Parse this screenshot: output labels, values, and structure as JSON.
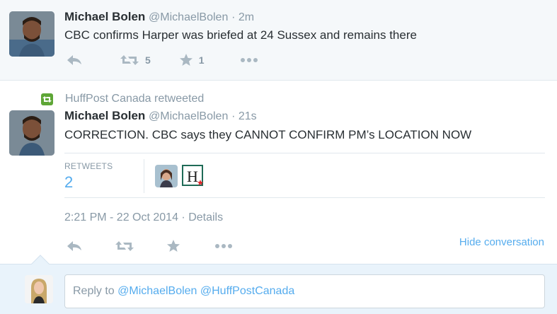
{
  "tweet1": {
    "display_name": "Michael Bolen",
    "handle": "@MichaelBolen",
    "time": "· 2m",
    "text": "CBC confirms Harper was briefed at 24 Sussex and remains there",
    "retweet_count": "5",
    "favorite_count": "1"
  },
  "retweet_context": {
    "text": "HuffPost Canada retweeted"
  },
  "tweet2": {
    "display_name": "Michael Bolen",
    "handle": "@MichaelBolen",
    "time": "· 21s",
    "text": "CORRECTION. CBC says they CANNOT CONFIRM PM’s LOCATION NOW",
    "stats": {
      "retweets_label": "RETWEETS",
      "retweets_value": "2"
    },
    "timestamp": "2:21 PM - 22 Oct 2014 · Details",
    "hide_conversation": "Hide conversation"
  },
  "reply": {
    "prefix": "Reply to ",
    "mentions": "@MichaelBolen @HuffPostCanada"
  },
  "colors": {
    "accent": "#55acee",
    "muted": "#8899a6",
    "icon": "#aab8c2",
    "retweet_green": "#5ea636"
  },
  "icons": [
    "reply-icon",
    "retweet-icon",
    "favorite-icon",
    "more-icon",
    "retweeted-badge-icon"
  ]
}
